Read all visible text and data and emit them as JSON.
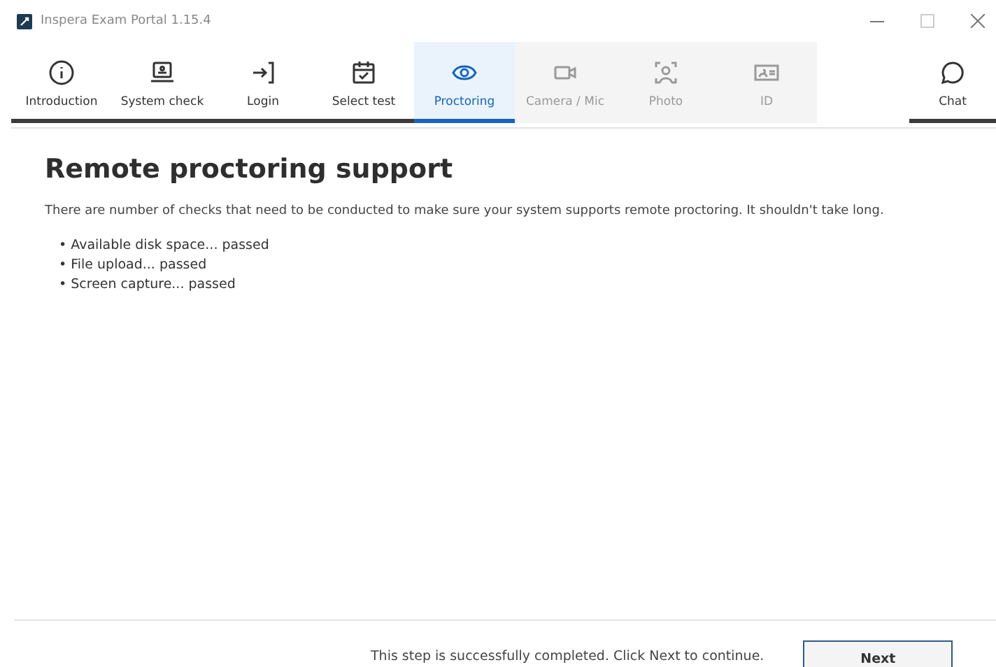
{
  "window": {
    "title": "Inspera Exam Portal 1.15.4"
  },
  "steps": [
    {
      "label": "Introduction",
      "selected": false,
      "disabled": false
    },
    {
      "label": "System check",
      "selected": false,
      "disabled": false
    },
    {
      "label": "Login",
      "selected": false,
      "disabled": false
    },
    {
      "label": "Select test",
      "selected": false,
      "disabled": false
    },
    {
      "label": "Proctoring",
      "selected": true,
      "disabled": false
    },
    {
      "label": "Camera / Mic",
      "selected": false,
      "disabled": true
    },
    {
      "label": "Photo",
      "selected": false,
      "disabled": true
    },
    {
      "label": "ID",
      "selected": false,
      "disabled": true
    }
  ],
  "chat": {
    "label": "Chat"
  },
  "content": {
    "heading": "Remote proctoring support",
    "intro": "There are number of checks that need to be conducted to make sure your system supports remote proctoring. It shouldn't take long.",
    "checks": [
      "• Available disk space... passed",
      "• File upload... passed",
      "• Screen capture... passed"
    ]
  },
  "footer": {
    "message": "This step is successfully completed. Click Next to continue.",
    "button": "Next"
  }
}
